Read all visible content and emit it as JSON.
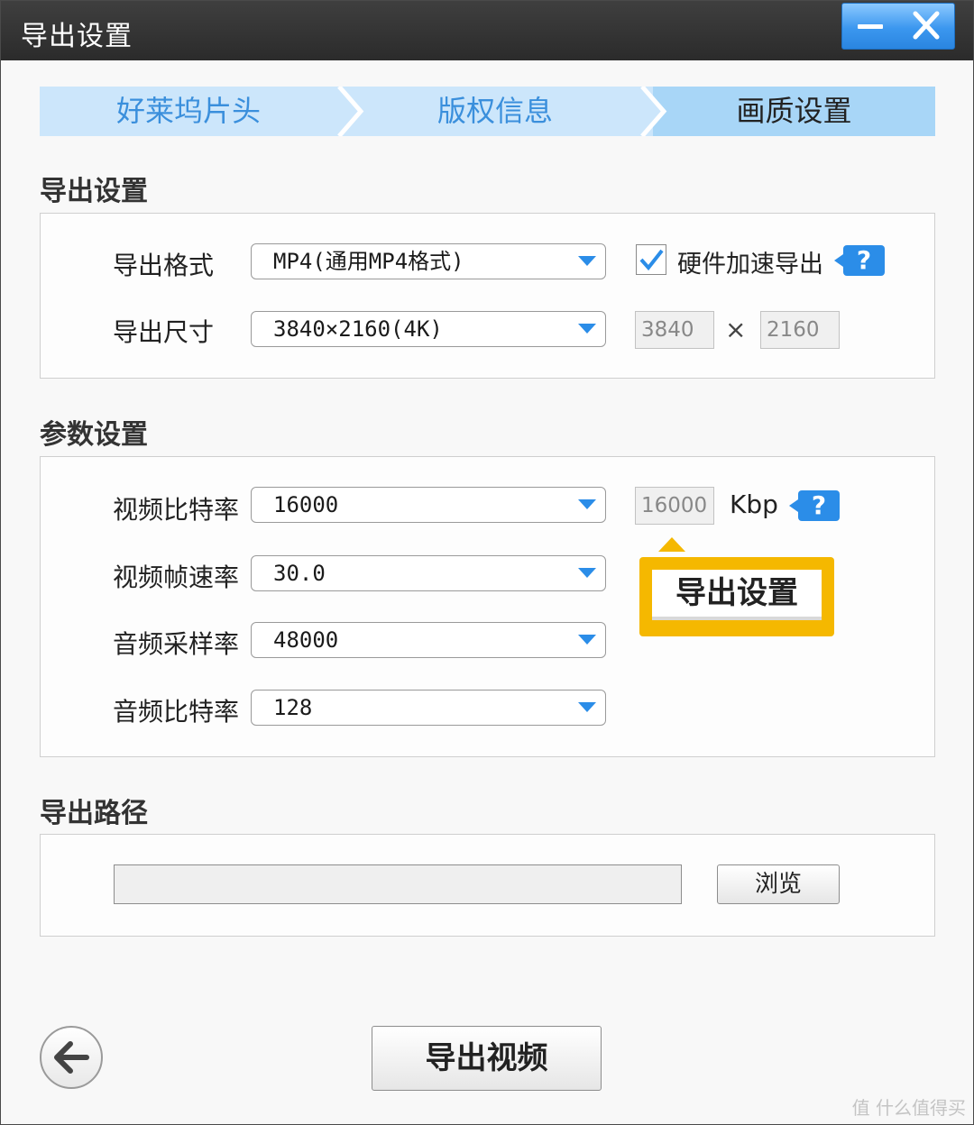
{
  "window": {
    "title": "导出设置"
  },
  "steps": [
    "好莱坞片头",
    "版权信息",
    "画质设置"
  ],
  "export_settings": {
    "section_title": "导出设置",
    "format_label": "导出格式",
    "format_value": "MP4(通用MP4格式)",
    "hw_accel_label": "硬件加速导出",
    "hw_accel_checked": true,
    "size_label": "导出尺寸",
    "size_value": "3840×2160(4K)",
    "width": "3840",
    "times": "×",
    "height": "2160"
  },
  "params": {
    "section_title": "参数设置",
    "video_bitrate_label": "视频比特率",
    "video_bitrate_value": "16000",
    "bitrate_box": "16000",
    "bitrate_unit": "Kbp",
    "frame_rate_label": "视频帧速率",
    "frame_rate_value": "30.0",
    "audio_sample_label": "音频采样率",
    "audio_sample_value": "48000",
    "audio_bitrate_label": "音频比特率",
    "audio_bitrate_value": "128"
  },
  "callout": {
    "text": "导出设置"
  },
  "help": {
    "glyph": "?"
  },
  "output_path": {
    "section_title": "导出路径",
    "path_value": "",
    "browse_label": "浏览"
  },
  "footer": {
    "export_label": "导出视频"
  },
  "watermark": "值 什么值得买",
  "colors": {
    "accent": "#2b8de8",
    "callout": "#f5b800",
    "step_bg": "#cce6fb",
    "titlebar": "#2b2b2b"
  }
}
